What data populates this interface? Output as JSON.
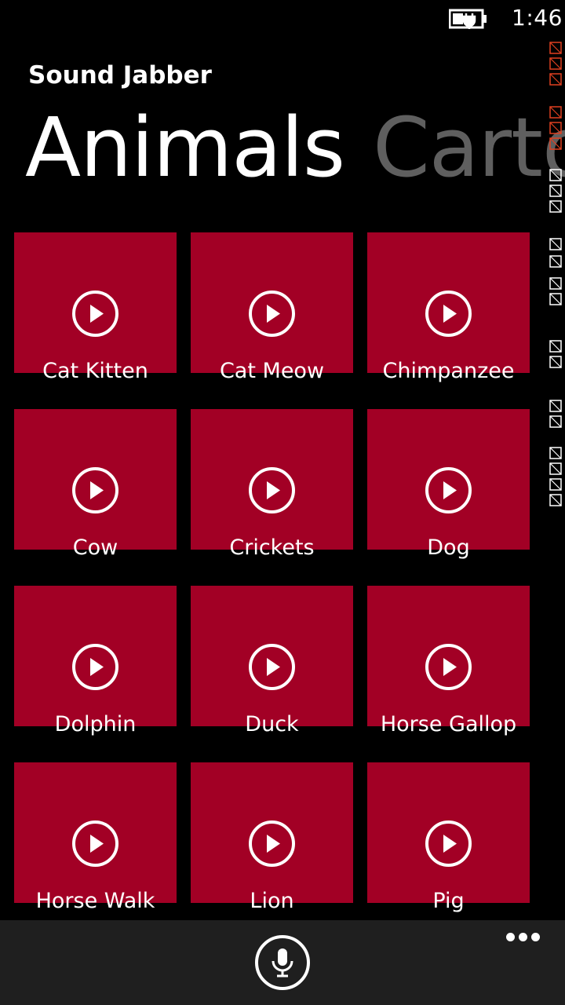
{
  "status_bar": {
    "time": "1:46",
    "battery_icon": "battery-charging-icon"
  },
  "app": {
    "title": "Sound Jabber"
  },
  "pivot": {
    "items": [
      "Animals",
      "Cartoons"
    ],
    "active_index": 0
  },
  "theme": {
    "tile_color": "#a20025",
    "app_bar_color": "#1f1f1f",
    "inactive_pivot_color": "#5f5f5f"
  },
  "tiles": [
    {
      "label": "Cat Kitten",
      "icon": "play-icon"
    },
    {
      "label": "Cat Meow",
      "icon": "play-icon"
    },
    {
      "label": "Chimpanzee",
      "icon": "play-icon"
    },
    {
      "label": "Cow",
      "icon": "play-icon"
    },
    {
      "label": "Crickets",
      "icon": "play-icon"
    },
    {
      "label": "Dog",
      "icon": "play-icon"
    },
    {
      "label": "Dolphin",
      "icon": "play-icon"
    },
    {
      "label": "Duck",
      "icon": "play-icon"
    },
    {
      "label": "Horse Gallop",
      "icon": "play-icon"
    },
    {
      "label": "Horse Walk",
      "icon": "play-icon"
    },
    {
      "label": "Lion",
      "icon": "play-icon"
    },
    {
      "label": "Pig",
      "icon": "play-icon"
    }
  ],
  "app_bar": {
    "primary_icon": "microphone-icon",
    "overflow_icon": "more-icon"
  }
}
